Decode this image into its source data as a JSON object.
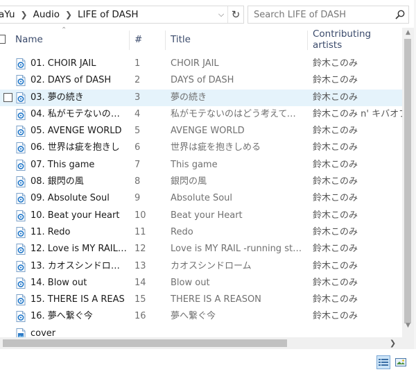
{
  "address": {
    "crumbs": [
      "aYu",
      "Audio",
      "LIFE of DASH"
    ]
  },
  "search": {
    "placeholder": "Search LIFE of DASH"
  },
  "columns": {
    "name": "Name",
    "number": "#",
    "title": "Title",
    "artists": "Contributing artists"
  },
  "files": [
    {
      "name": "01. CHOIR JAIL",
      "num": "1",
      "title": "CHOIR JAIL",
      "artist": "鈴木このみ",
      "selected": false
    },
    {
      "name": "02. DAYS of DASH",
      "num": "2",
      "title": "DAYS of DASH",
      "artist": "鈴木このみ",
      "selected": false
    },
    {
      "name": "03. 夢の続き",
      "num": "3",
      "title": "夢の続き",
      "artist": "鈴木このみ",
      "selected": true
    },
    {
      "name": "04. 私がモテないのは...",
      "num": "4",
      "title": "私がモテないのはどう考えてもお...",
      "artist": "鈴木このみ n' キバオブ",
      "selected": false
    },
    {
      "name": "05. AVENGE WORLD",
      "num": "5",
      "title": "AVENGE WORLD",
      "artist": "鈴木このみ",
      "selected": false
    },
    {
      "name": "06. 世界は疵を抱きし",
      "num": "6",
      "title": "世界は疵を抱きしめる",
      "artist": "鈴木このみ",
      "selected": false
    },
    {
      "name": "07. This game",
      "num": "7",
      "title": "This game",
      "artist": "鈴木このみ",
      "selected": false
    },
    {
      "name": "08. 銀閃の風",
      "num": "8",
      "title": "銀閃の風",
      "artist": "鈴木このみ",
      "selected": false
    },
    {
      "name": "09. Absolute Soul",
      "num": "9",
      "title": "Absolute Soul",
      "artist": "鈴木このみ",
      "selected": false
    },
    {
      "name": "10. Beat your Heart",
      "num": "10",
      "title": "Beat your Heart",
      "artist": "鈴木このみ",
      "selected": false
    },
    {
      "name": "11. Redo",
      "num": "11",
      "title": "Redo",
      "artist": "鈴木このみ",
      "selected": false
    },
    {
      "name": "12. Love is MY RAIL ...",
      "num": "12",
      "title": "Love is MY RAIL -running start-",
      "artist": "鈴木このみ",
      "selected": false
    },
    {
      "name": "13. カオスシンドローム",
      "num": "13",
      "title": "カオスシンドローム",
      "artist": "鈴木このみ",
      "selected": false
    },
    {
      "name": "14. Blow out",
      "num": "14",
      "title": "Blow out",
      "artist": "鈴木このみ",
      "selected": false
    },
    {
      "name": "15. THERE IS A REAS",
      "num": "15",
      "title": "THERE IS A REASON",
      "artist": "鈴木このみ",
      "selected": false
    },
    {
      "name": "16. 夢へ繋ぐ今",
      "num": "16",
      "title": "夢へ繋ぐ今",
      "artist": "鈴木このみ",
      "selected": false
    },
    {
      "name": "cover",
      "num": "",
      "title": "",
      "artist": "",
      "selected": false,
      "kind": "image"
    }
  ],
  "colors": {
    "accent": "#0078d7",
    "selection": "#e5f3fb",
    "header_text": "#3a4a6b"
  },
  "icons": {
    "audio": "audio-file-icon",
    "image": "image-file-icon"
  }
}
